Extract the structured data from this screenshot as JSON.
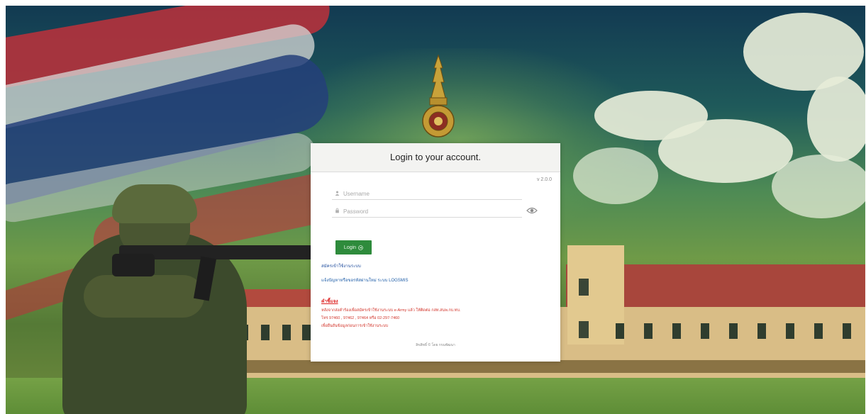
{
  "login": {
    "title": "Login to your account.",
    "version": "v 2.0.0",
    "username_placeholder": "Username",
    "password_placeholder": "Password",
    "login_button": "Login",
    "login_icon": "arrow-right-circle-icon",
    "register_link": "สมัครเข้าใช้งานระบบ",
    "user_link": "แจ้งปัญหาหรือขอรหัสผ่านใหม่ ระบบ LOGSMIS",
    "note_heading": "คำชี้แจง",
    "note_lines": [
      "หลังจากส่งคำร้องเพื่อสมัครเข้าใช้งานระบบ e-Army แล้ว ให้ติดต่อ กสท.สนพ.กบ.ทบ.",
      "โทร 97460 , 97462 , 97464 หรือ 02-297-7460",
      "เพื่อยืนยันข้อมูลก่อนการเข้าใช้งานระบบ"
    ],
    "footer": "ลิขสิทธิ์ © โดย กรมพัฒนา"
  },
  "colors": {
    "button_green": "#2e8b3c",
    "link_blue": "#1f4c9c",
    "note_red": "#d2342a"
  },
  "icons": {
    "user": "user-icon",
    "lock": "lock-icon",
    "eye": "eye-icon"
  }
}
